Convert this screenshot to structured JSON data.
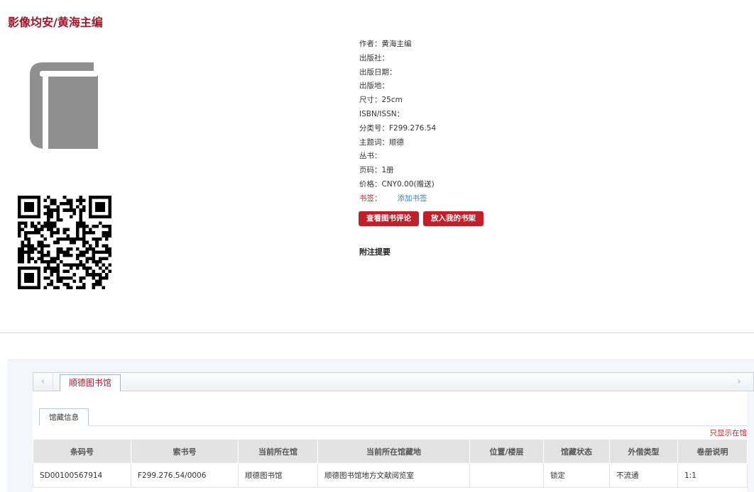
{
  "page": {
    "title": "影像均安/黄海主编"
  },
  "meta": {
    "author": {
      "label": "作者：",
      "value": "黄海主编"
    },
    "publisher": {
      "label": "出版社：",
      "value": ""
    },
    "pub_date": {
      "label": "出版日期：",
      "value": ""
    },
    "pub_place": {
      "label": "出版地：",
      "value": ""
    },
    "size": {
      "label": "尺寸：",
      "value": "25cm"
    },
    "isbn": {
      "label": "ISBN/ISSN：",
      "value": ""
    },
    "classno": {
      "label": "分类号：",
      "value": "F299.276.54"
    },
    "subject": {
      "label": "主题词：",
      "value": "顺德"
    },
    "series": {
      "label": "丛书：",
      "value": ""
    },
    "pages": {
      "label": "页码：",
      "value": "1册"
    },
    "price": {
      "label": "价格：",
      "value": "CNY0.00(赠送)"
    },
    "bookmark": {
      "label": "书签：",
      "link": "添加书签"
    }
  },
  "buttons": {
    "reviews": "查看图书评论",
    "shelf": "放入我的书架"
  },
  "notes": {
    "title": "附注提要"
  },
  "tabs": {
    "prev": "‹",
    "next": "›",
    "active": "顺德图书馆"
  },
  "holdings": {
    "subtab": "馆藏信息",
    "only_link": "只显示在馆",
    "columns": [
      "条码号",
      "索书号",
      "当前所在馆",
      "当前所在馆藏地",
      "位置/楼层",
      "馆藏状态",
      "外借类型",
      "卷册说明"
    ],
    "rows": [
      [
        "SD00100567914",
        "F299.276.54/0006",
        "顺德图书馆",
        "顺德图书馆地方文献阅览室",
        "",
        "锁定",
        "不流通",
        "1:1"
      ]
    ]
  },
  "icons": {
    "cover": "book-icon",
    "qr": "qr-code"
  },
  "colors": {
    "accent": "#a0172b",
    "button": "#c1202a",
    "link": "#3a7fc1"
  }
}
